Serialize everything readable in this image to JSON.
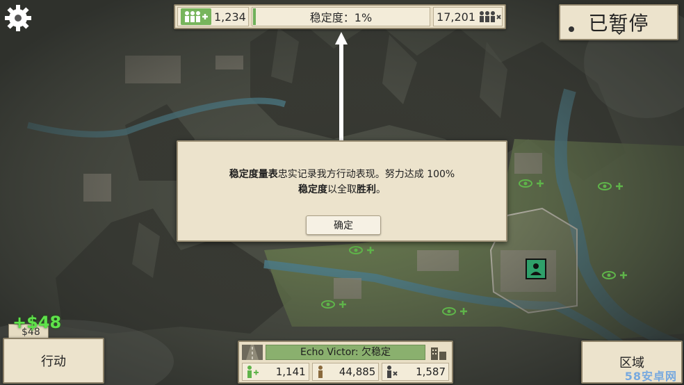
{
  "topbar": {
    "supporters": "1,234",
    "stability_label": "稳定度：1%",
    "stability_fraction": 0.01,
    "enemies": "17,201"
  },
  "pause": {
    "label": "已暂停"
  },
  "dialog": {
    "term1": "稳定度量表",
    "text1": "忠实记录我方行动表现。努力达成 100%",
    "term2": "稳定度",
    "text2": "以全取",
    "term3": "胜利",
    "text3": "。",
    "ok_label": "确定"
  },
  "money": {
    "gain": "+$48",
    "balance": "$48"
  },
  "action_button": {
    "label": "行动"
  },
  "region": {
    "name": "Echo Victor: 欠稳定",
    "supporters": "1,141",
    "neutral": "44,885",
    "enemies": "1,587"
  },
  "area_button": {
    "label": "区域"
  },
  "watermark": "58安卓网",
  "colors": {
    "panel": "#ece3cc",
    "supporter_green": "#6fb05a",
    "river": "#4e8ea3",
    "money_green": "#5ee24a"
  },
  "icons": [
    "gear-icon",
    "supporters-icon",
    "enemies-icon",
    "chevron-down-icon",
    "road-icon",
    "building-icon",
    "visibility-plus-icon",
    "base-icon"
  ]
}
